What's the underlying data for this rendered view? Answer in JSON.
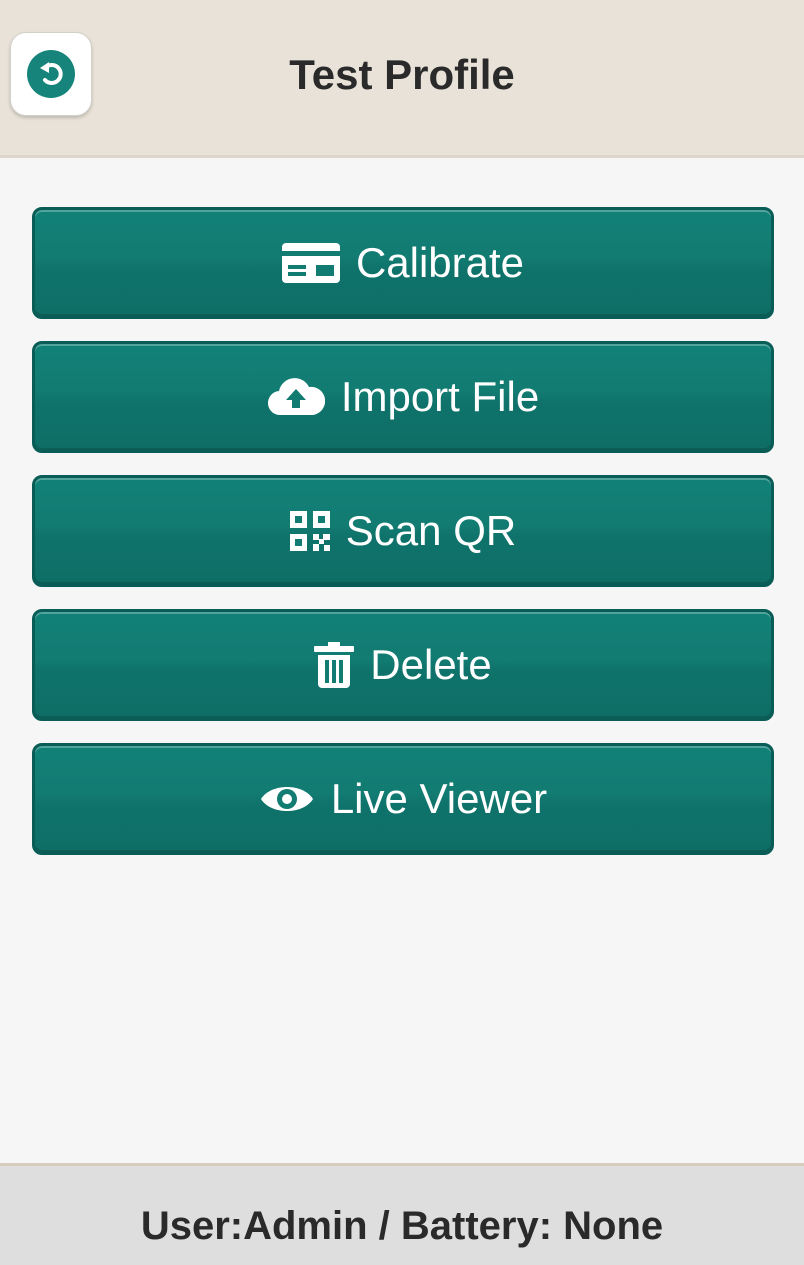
{
  "header": {
    "title": "Test Profile",
    "back_icon": "undo-icon"
  },
  "menu": {
    "items": [
      {
        "label": "Calibrate",
        "icon": "card-icon"
      },
      {
        "label": "Import File",
        "icon": "cloud-upload-icon"
      },
      {
        "label": "Scan QR",
        "icon": "qr-code-icon"
      },
      {
        "label": "Delete",
        "icon": "trash-icon"
      },
      {
        "label": "Live Viewer",
        "icon": "eye-icon"
      }
    ]
  },
  "footer": {
    "status": "User:Admin / Battery: None"
  },
  "colors": {
    "accent": "#127b72",
    "header_bg": "#e8e2d8",
    "footer_bg": "#dedede",
    "page_bg": "#f6f6f6"
  }
}
